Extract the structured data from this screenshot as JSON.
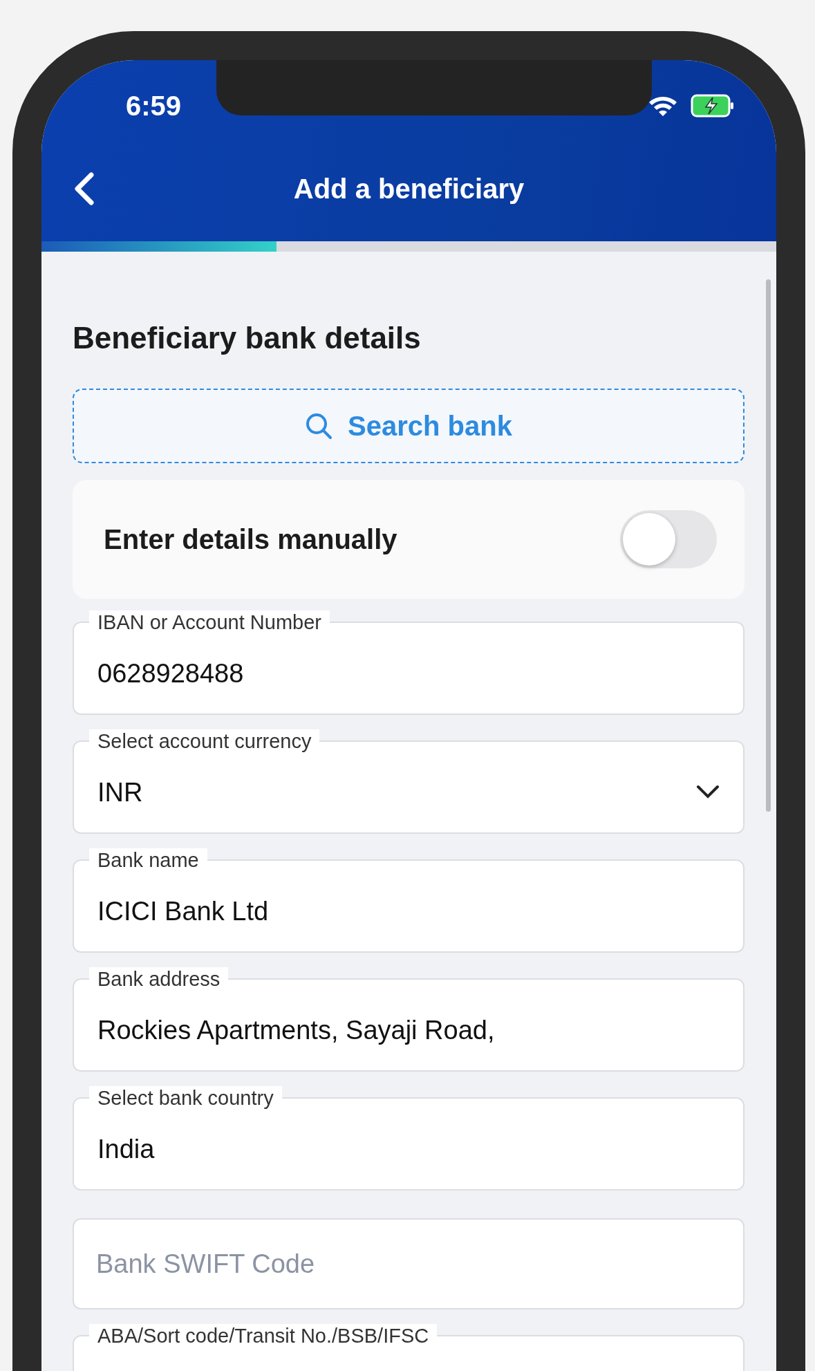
{
  "status_bar": {
    "time": "6:59"
  },
  "header": {
    "title": "Add a beneficiary"
  },
  "progress": {
    "level": 0.32
  },
  "section_title": "Beneficiary bank details",
  "search": {
    "label": "Search bank"
  },
  "manual": {
    "label": "Enter details manually",
    "on": false
  },
  "fields": [
    {
      "kind": "text",
      "label": "IBAN or Account Number",
      "value": "0628928488"
    },
    {
      "kind": "select",
      "label": "Select account currency",
      "value": "INR"
    },
    {
      "kind": "text",
      "label": "Bank name",
      "value": "ICICI Bank Ltd"
    },
    {
      "kind": "text",
      "label": "Bank address",
      "value": "Rockies Apartments, Sayaji Road,"
    },
    {
      "kind": "text",
      "label": "Select bank country",
      "value": "India"
    },
    {
      "kind": "empty",
      "placeholder": "Bank SWIFT Code"
    },
    {
      "kind": "text",
      "label": "ABA/Sort code/Transit No./BSB/IFSC"
    }
  ]
}
